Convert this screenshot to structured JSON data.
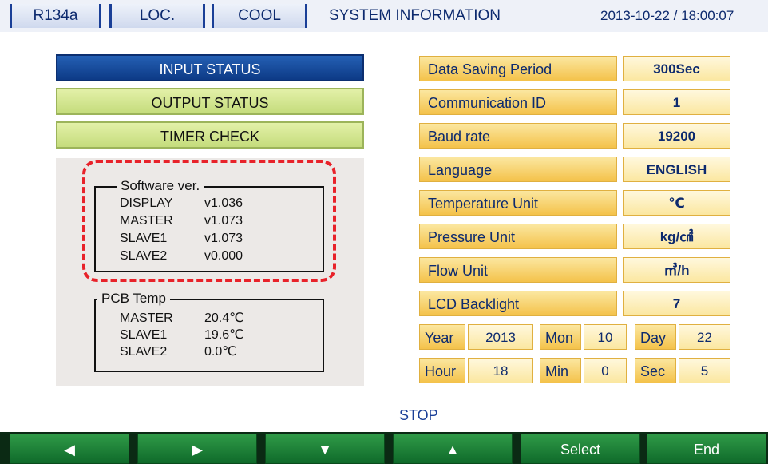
{
  "topbar": {
    "refrigerant": "R134a",
    "mode": "LOC.",
    "operation": "COOL",
    "title": "SYSTEM INFORMATION",
    "datetime": "2013-10-22 / 18:00:07"
  },
  "menu": {
    "input_status": "INPUT STATUS",
    "output_status": "OUTPUT STATUS",
    "timer_check": "TIMER CHECK"
  },
  "software": {
    "title": "Software ver.",
    "rows": [
      {
        "name": "DISPLAY",
        "value": "v1.036"
      },
      {
        "name": "MASTER",
        "value": "v1.073"
      },
      {
        "name": "SLAVE1",
        "value": "v1.073"
      },
      {
        "name": "SLAVE2",
        "value": "v0.000"
      }
    ]
  },
  "pcb_temp": {
    "title": "PCB Temp",
    "rows": [
      {
        "name": "MASTER",
        "value": "20.4℃"
      },
      {
        "name": "SLAVE1",
        "value": "19.6℃"
      },
      {
        "name": "SLAVE2",
        "value": "0.0℃"
      }
    ]
  },
  "settings": [
    {
      "label": "Data Saving Period",
      "value": "300Sec"
    },
    {
      "label": "Communication ID",
      "value": "1"
    },
    {
      "label": "Baud rate",
      "value": "19200"
    },
    {
      "label": "Language",
      "value": "ENGLISH"
    },
    {
      "label": "Temperature  Unit",
      "value": "℃"
    },
    {
      "label": "Pressure Unit",
      "value": "kg/㎠"
    },
    {
      "label": "Flow Unit",
      "value": "㎥/h"
    },
    {
      "label": "LCD Backlight",
      "value": "7"
    }
  ],
  "datetime_fields": {
    "year_label": "Year",
    "year_value": "2013",
    "mon_label": "Mon",
    "mon_value": "10",
    "day_label": "Day",
    "day_value": "22",
    "hour_label": "Hour",
    "hour_value": "18",
    "min_label": "Min",
    "min_value": "0",
    "sec_label": "Sec",
    "sec_value": "5"
  },
  "status": "STOP",
  "bottom_buttons": {
    "left": "◀",
    "right": "▶",
    "down": "▼",
    "up": "▲",
    "select": "Select",
    "end": "End"
  },
  "colors": {
    "accent_blue": "#0d3a86",
    "menu_green": "#c5dc7c",
    "setting_gold": "#f4c24a",
    "bottom_green": "#1a7a33",
    "highlight_red": "#e8222a"
  }
}
